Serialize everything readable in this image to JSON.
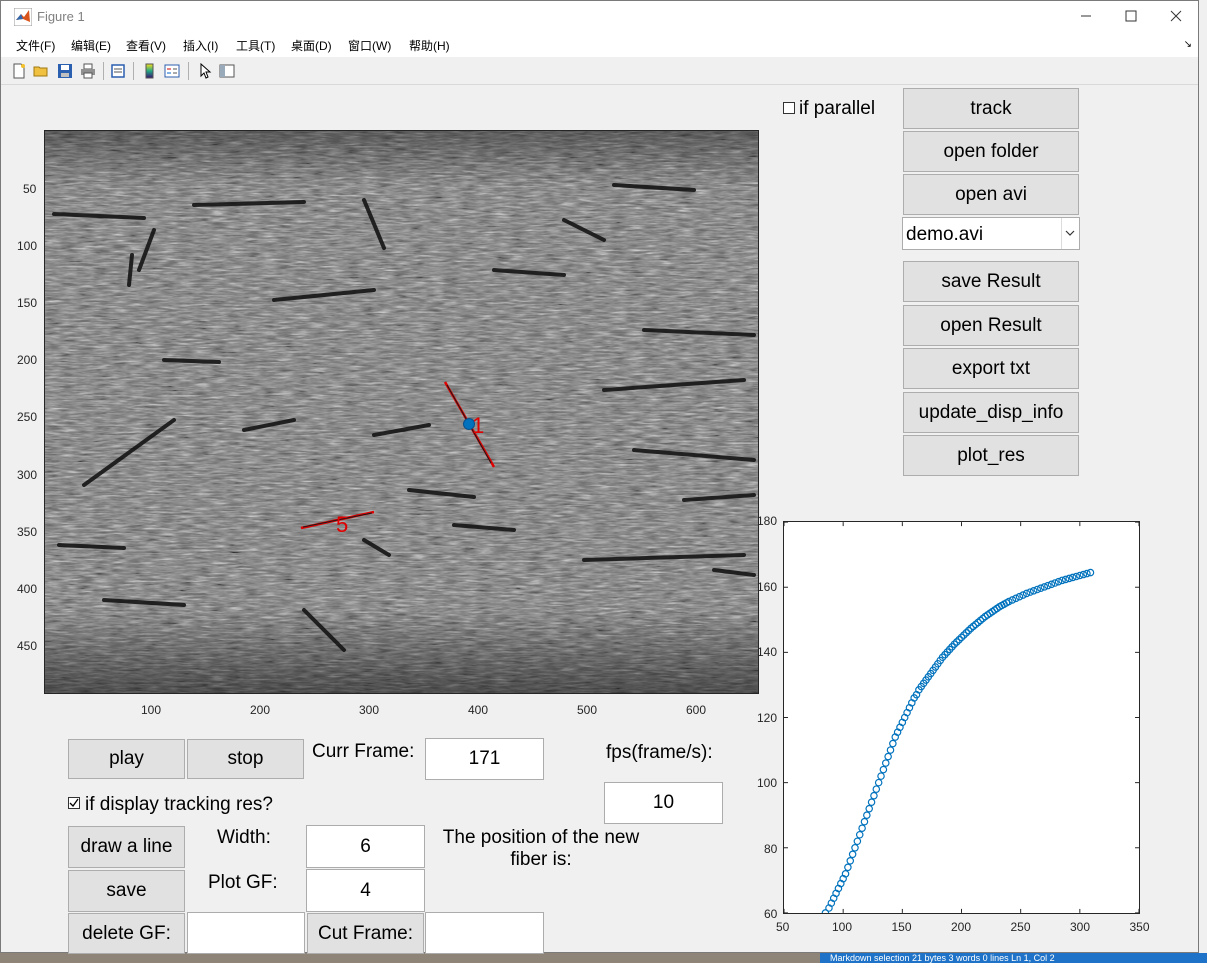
{
  "window": {
    "title": "Figure 1",
    "menu": [
      "文件(F)",
      "编辑(E)",
      "查看(V)",
      "插入(I)",
      "工具(T)",
      "桌面(D)",
      "窗口(W)",
      "帮助(H)"
    ]
  },
  "toolbar_icons": [
    "new-file-icon",
    "open-folder-icon",
    "save-icon",
    "print-icon",
    "print-preview-icon",
    "colorbar-icon",
    "legend-icon",
    "pointer-icon",
    "property-editor-icon"
  ],
  "image_axes": {
    "yticks": [
      "50",
      "100",
      "150",
      "200",
      "250",
      "300",
      "350",
      "400",
      "450"
    ],
    "xticks": [
      "100",
      "200",
      "300",
      "400",
      "500",
      "600"
    ],
    "annotations": [
      {
        "label": "1",
        "color": "#e00000"
      },
      {
        "label": "5",
        "color": "#e00000"
      }
    ]
  },
  "controls": {
    "if_parallel_label": "if parallel",
    "track": "track",
    "open_folder": "open folder",
    "open_avi": "open avi",
    "file_select": "demo.avi",
    "save_result": "save Result",
    "open_result": "open Result",
    "export_txt": "export txt",
    "update_disp_info": "update_disp_info",
    "plot_res": "plot_res",
    "play": "play",
    "stop": "stop",
    "curr_frame_label": "Curr Frame:",
    "curr_frame_value": "171",
    "fps_label": "fps(frame/s):",
    "fps_value": "10",
    "if_display_label": "if display tracking res?",
    "if_display_checked": true,
    "draw_line": "draw a line",
    "width_label": "Width:",
    "width_value": "6",
    "position_text": "The position of the new fiber is:",
    "save": "save",
    "plot_gf_label": "Plot GF:",
    "plot_gf_value": "4",
    "delete_gf": "delete GF:",
    "delete_gf_value": "",
    "cut_frame": "Cut Frame:",
    "cut_frame_value": ""
  },
  "status_text": "Markdown selection   21 bytes   3 words   0 lines   Ln 1, Col 2",
  "chart_data": {
    "type": "scatter",
    "marker": "circle-open",
    "color": "#0072bd",
    "xlim": [
      50,
      350
    ],
    "ylim": [
      60,
      180
    ],
    "xticks": [
      50,
      100,
      150,
      200,
      250,
      300,
      350
    ],
    "yticks": [
      60,
      80,
      100,
      120,
      140,
      160,
      180
    ],
    "xtick_labels": [
      "50",
      "100",
      "150",
      "200",
      "250",
      "300",
      "350"
    ],
    "ytick_labels": [
      "60",
      "80",
      "100",
      "120",
      "140",
      "160",
      "180"
    ],
    "x": [
      85,
      88,
      90,
      92,
      94,
      96,
      98,
      100,
      102,
      104,
      106,
      108,
      110,
      112,
      114,
      116,
      118,
      120,
      122,
      124,
      126,
      128,
      130,
      132,
      134,
      136,
      138,
      140,
      142,
      144,
      146,
      148,
      150,
      152,
      154,
      156,
      158,
      160,
      162,
      164,
      166,
      168,
      170,
      172,
      174,
      176,
      178,
      180,
      182,
      184,
      186,
      188,
      190,
      192,
      194,
      196,
      198,
      200,
      202,
      204,
      206,
      208,
      210,
      212,
      214,
      216,
      218,
      220,
      222,
      224,
      226,
      228,
      230,
      232,
      234,
      236,
      238,
      240,
      243,
      246,
      249,
      252,
      255,
      258,
      261,
      264,
      267,
      270,
      273,
      276,
      279,
      282,
      285,
      288,
      291,
      294,
      297,
      300,
      303,
      306,
      309
    ],
    "y": [
      60,
      61.5,
      63,
      64.5,
      66,
      67.5,
      69,
      70.5,
      72,
      74,
      76,
      78,
      80,
      82,
      84,
      86,
      88,
      90,
      92,
      94,
      96,
      98,
      100,
      102,
      104,
      106,
      108,
      110,
      112,
      114,
      115.5,
      117,
      118.5,
      120,
      121.5,
      123,
      124.5,
      126,
      127,
      128.5,
      129.5,
      130.5,
      131.5,
      132.5,
      133.5,
      134.5,
      135.5,
      136.5,
      137.5,
      138.5,
      139.3,
      140.1,
      140.9,
      141.7,
      142.5,
      143.2,
      143.9,
      144.6,
      145.3,
      146,
      146.7,
      147.4,
      148,
      148.6,
      149.2,
      149.8,
      150.4,
      151,
      151.5,
      152,
      152.5,
      153,
      153.5,
      154,
      154.4,
      154.8,
      155.2,
      155.6,
      156.1,
      156.6,
      157.1,
      157.6,
      158.1,
      158.5,
      158.9,
      159.3,
      159.7,
      160.1,
      160.5,
      160.9,
      161.3,
      161.7,
      162.1,
      162.4,
      162.7,
      163,
      163.3,
      163.6,
      163.9,
      164.2,
      164.5
    ]
  }
}
